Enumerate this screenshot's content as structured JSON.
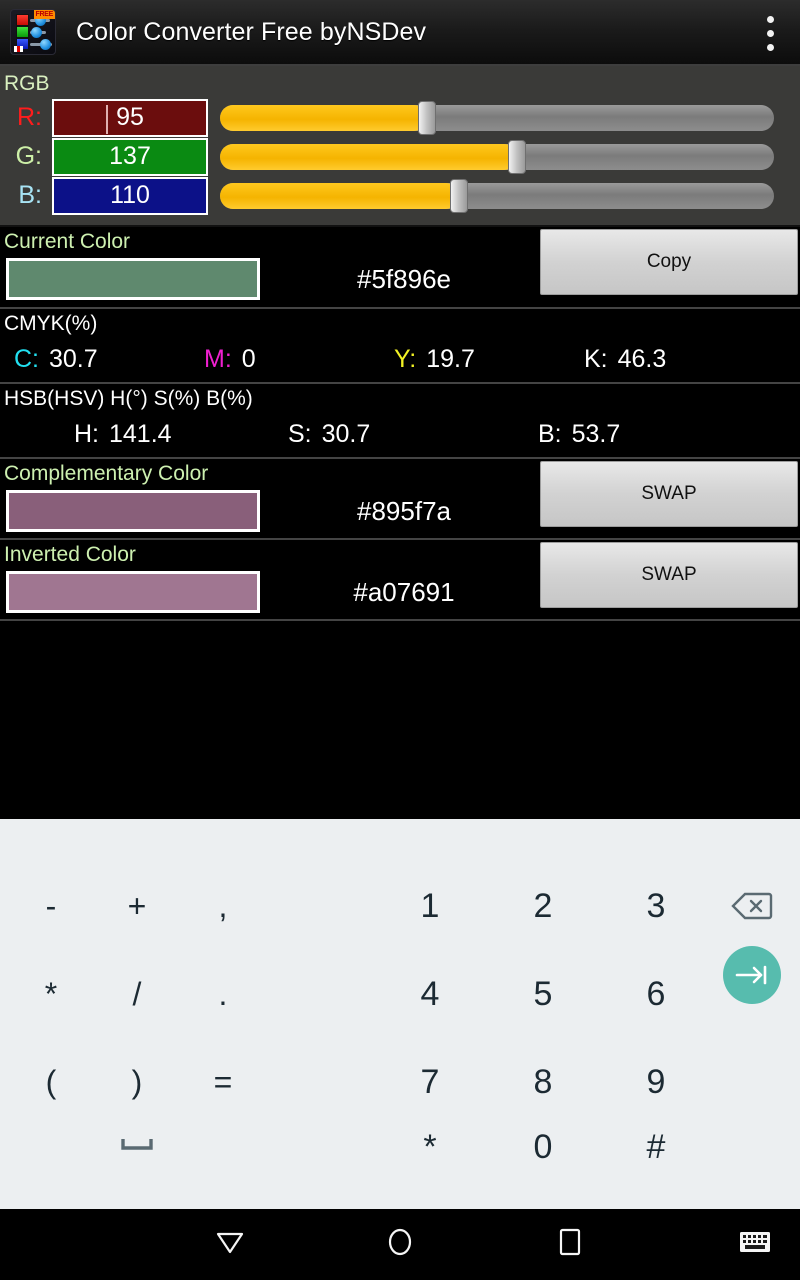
{
  "titlebar": {
    "app_title": "Color Converter Free byNSDev",
    "icon_name": "app-logo-icon",
    "icon_badge": "FREE",
    "overflow_label": "more-options"
  },
  "rgb": {
    "header": "RGB",
    "channels": [
      {
        "label": "R:",
        "value": "95",
        "slider_percent": 37.3,
        "label_color": "#ff1c1c",
        "field_bg": "#6b0d0d",
        "focused": true
      },
      {
        "label": "G:",
        "value": "137",
        "slider_percent": 53.7,
        "label_color": "#cdf0a8",
        "field_bg": "#0a8a12",
        "focused": false
      },
      {
        "label": "B:",
        "value": "110",
        "slider_percent": 43.1,
        "label_color": "#a8e4f5",
        "field_bg": "#0c1188",
        "focused": false
      }
    ]
  },
  "current_color": {
    "label": "Current Color",
    "hex": "#5f896e",
    "swatch_color": "#5f896e",
    "button_label": "Copy"
  },
  "cmyk": {
    "header": "CMYK(%)",
    "values": [
      {
        "key": "C:",
        "value": "30.7",
        "key_color": "#22e0f0"
      },
      {
        "key": "M:",
        "value": "0",
        "key_color": "#f020d0"
      },
      {
        "key": "Y:",
        "value": "19.7",
        "key_color": "#f2f224"
      },
      {
        "key": "K:",
        "value": "46.3",
        "key_color": "#ffffff"
      }
    ]
  },
  "hsb": {
    "header": "HSB(HSV) H(°) S(%) B(%)",
    "values": [
      {
        "key": "H:",
        "value": "141.4"
      },
      {
        "key": "S:",
        "value": "30.7"
      },
      {
        "key": "B:",
        "value": "53.7"
      }
    ]
  },
  "complementary_color": {
    "label": "Complementary Color",
    "hex": "#895f7a",
    "swatch_color": "#895f7a",
    "button_label": "SWAP"
  },
  "inverted_color": {
    "label": "Inverted Color",
    "hex": "#a07691",
    "swatch_color": "#a07691",
    "button_label": "SWAP"
  },
  "keyboard": {
    "symbol_keys": [
      {
        "label": "-",
        "name": "key-minus"
      },
      {
        "label": "+",
        "name": "key-plus"
      },
      {
        "label": ",",
        "name": "key-comma"
      },
      {
        "label": "*",
        "name": "key-asterisk-left"
      },
      {
        "label": "/",
        "name": "key-slash"
      },
      {
        "label": ".",
        "name": "key-period"
      },
      {
        "label": "(",
        "name": "key-paren-open"
      },
      {
        "label": ")",
        "name": "key-paren-close"
      },
      {
        "label": "=",
        "name": "key-equals"
      }
    ],
    "space_key": {
      "label": "⌴",
      "name": "key-space"
    },
    "number_keys": [
      {
        "label": "1",
        "name": "key-1"
      },
      {
        "label": "2",
        "name": "key-2"
      },
      {
        "label": "3",
        "name": "key-3"
      },
      {
        "label": "4",
        "name": "key-4"
      },
      {
        "label": "5",
        "name": "key-5"
      },
      {
        "label": "6",
        "name": "key-6"
      },
      {
        "label": "7",
        "name": "key-7"
      },
      {
        "label": "8",
        "name": "key-8"
      },
      {
        "label": "9",
        "name": "key-9"
      },
      {
        "label": "*",
        "name": "key-asterisk"
      },
      {
        "label": "0",
        "name": "key-0"
      },
      {
        "label": "#",
        "name": "key-hash"
      }
    ],
    "backspace_name": "backspace-icon",
    "enter_name": "tab-next-icon",
    "enter_accent": "#57bcae"
  },
  "navbar": {
    "back_name": "back-icon",
    "home_name": "home-icon",
    "recents_name": "recents-icon",
    "keyboard_name": "keyboard-toggle-icon"
  }
}
